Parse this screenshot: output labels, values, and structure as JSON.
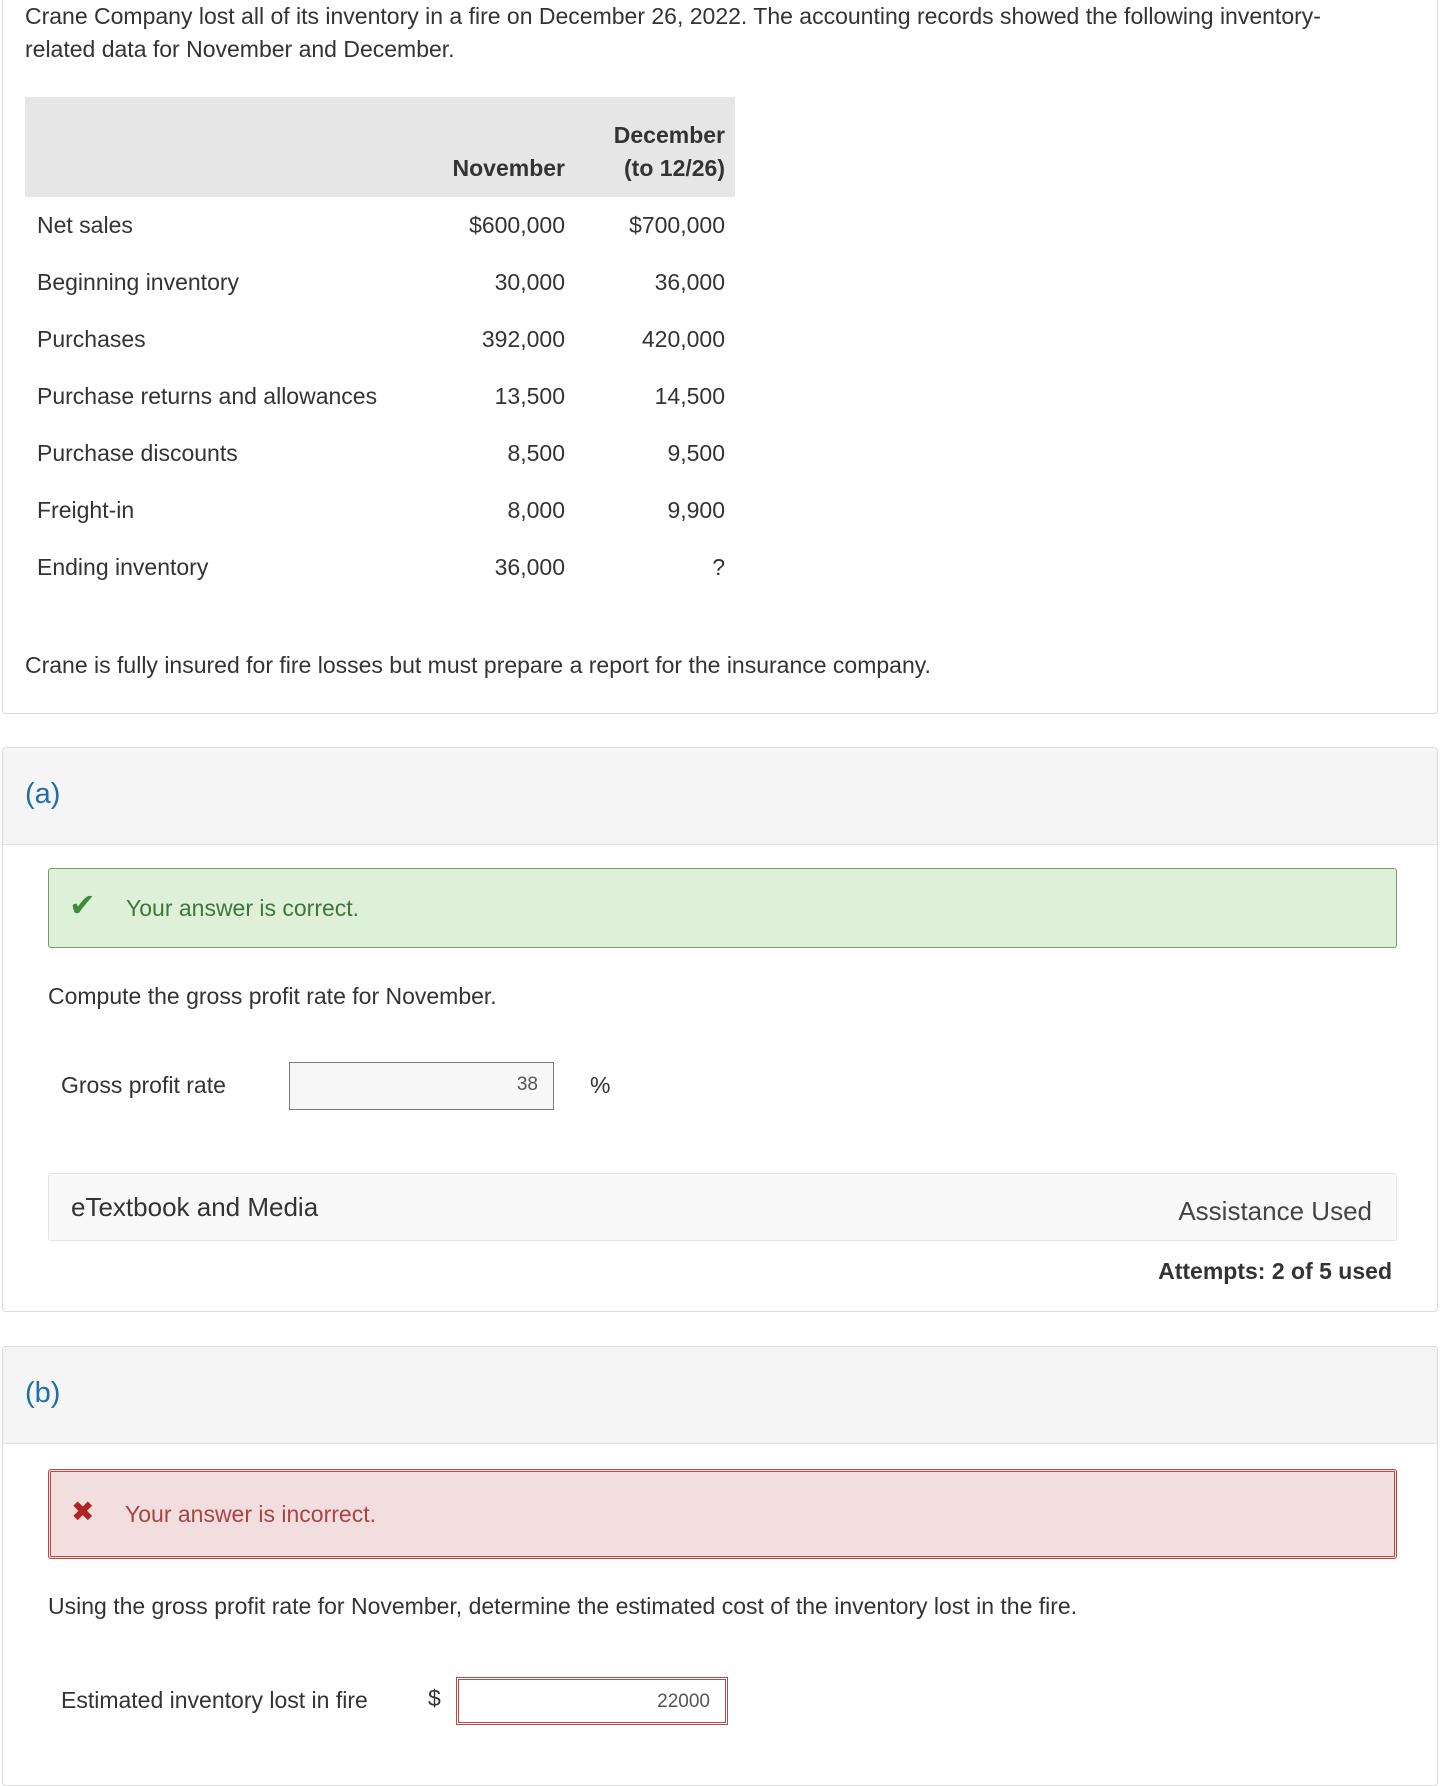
{
  "intro": {
    "text": "Crane Company lost all of its inventory in a fire on December 26, 2022. The accounting records showed the following inventory-related data for November and December.",
    "table": {
      "headers": [
        "",
        "November",
        "December (to 12/26)"
      ],
      "rows": [
        {
          "label": "Net sales",
          "nov": "$600,000",
          "dec": "$700,000"
        },
        {
          "label": "Beginning inventory",
          "nov": "30,000",
          "dec": "36,000"
        },
        {
          "label": "Purchases",
          "nov": "392,000",
          "dec": "420,000"
        },
        {
          "label": "Purchase returns and allowances",
          "nov": "13,500",
          "dec": "14,500"
        },
        {
          "label": "Purchase discounts",
          "nov": "8,500",
          "dec": "9,500"
        },
        {
          "label": "Freight-in",
          "nov": "8,000",
          "dec": "9,900"
        },
        {
          "label": "Ending inventory",
          "nov": "36,000",
          "dec": "?"
        }
      ]
    },
    "footnote": "Crane is fully insured for fire losses but must prepare a report for the insurance company."
  },
  "part_a": {
    "letter": "(a)",
    "feedback_text": "Your answer is correct.",
    "question": "Compute the gross profit rate for November.",
    "field_label": "Gross profit rate",
    "answer_value": "38",
    "unit": "%",
    "media_label": "eTextbook and Media",
    "assistance": "Assistance Used",
    "attempts": "Attempts: 2 of 5 used"
  },
  "part_b": {
    "letter": "(b)",
    "feedback_text": "Your answer is incorrect.",
    "question": "Using the gross profit rate for November, determine the estimated cost of the inventory lost in the fire.",
    "field_label": "Estimated inventory lost in fire",
    "currency": "$",
    "answer_value": "22000"
  },
  "colors": {
    "correct_bg": "#dff0d8",
    "incorrect_bg": "#f2dede",
    "incorrect_border": "#b94a48",
    "part_letter": "#1e6ea7"
  }
}
